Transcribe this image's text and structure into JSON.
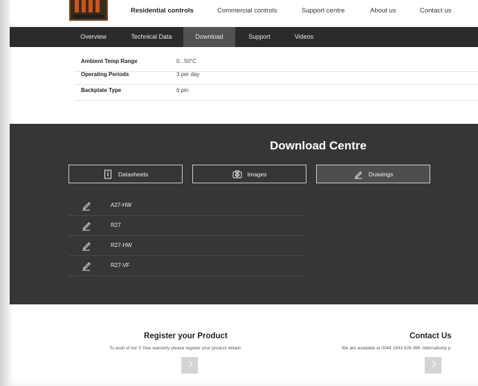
{
  "topnav": {
    "links": [
      "Residential controls",
      "Commercial controls",
      "Support centre",
      "About us",
      "Contact us"
    ]
  },
  "tabs": [
    "Overview",
    "Technical Data",
    "Download",
    "Support",
    "Videos"
  ],
  "active_tab": "Download",
  "specs": [
    {
      "label": "Ambient Temp Range",
      "value": "0...50°C"
    },
    {
      "label": "Operating Periods",
      "value": "3 per day"
    },
    {
      "label": "Backplate Type",
      "value": "6 pin"
    }
  ],
  "download": {
    "title": "Download Centre",
    "buttons": [
      {
        "label": "Datasheets",
        "icon": "datasheet-icon"
      },
      {
        "label": "Images",
        "icon": "camera-icon"
      },
      {
        "label": "Drawings",
        "icon": "pencil-icon"
      }
    ],
    "active_button": "Drawings",
    "items": [
      "A27-HW",
      "R27",
      "R27-HW",
      "R27-VF"
    ]
  },
  "register": {
    "title": "Register your Product",
    "text": "To avail of our 5 Year warranty please register your product details"
  },
  "contact": {
    "title": "Contact Us",
    "text": "We are available at 0044 1933 626 396. Alternatively p"
  },
  "colors": {
    "tabbar_bg": "#2b2b2b",
    "active_tab_bg": "#525252",
    "download_bg": "#363636"
  }
}
